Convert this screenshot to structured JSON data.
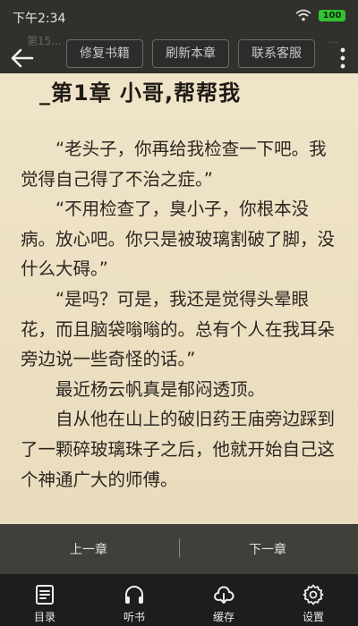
{
  "status": {
    "time": "下午2:34",
    "battery": "100"
  },
  "header": {
    "ghost_chapter": "第15...",
    "ghost_right": "...",
    "buttons": [
      "修复书籍",
      "刷新本章",
      "联系客服"
    ]
  },
  "chapter": {
    "title": "_第1章 小哥,帮帮我",
    "paragraphs": [
      "“老头子，你再给我检查一下吧。我觉得自己得了不治之症。”",
      "“不用检查了，臭小子，你根本没病。放心吧。你只是被玻璃割破了脚，没什么大碍。”",
      "“是吗？可是，我还是觉得头晕眼花，而且脑袋嗡嗡的。总有个人在我耳朵旁边说一些奇怪的话。”",
      "最近杨云帆真是郁闷透顶。",
      "自从他在山上的破旧药王庙旁边踩到了一颗碎玻璃珠子之后，他就开始自己这个神通广大的师傅。"
    ]
  },
  "chapter_nav": {
    "prev": "上一章",
    "next": "下一章"
  },
  "toolbar": {
    "items": [
      {
        "label": "目录",
        "icon": "catalog-icon"
      },
      {
        "label": "听书",
        "icon": "headphones-icon"
      },
      {
        "label": "缓存",
        "icon": "cloud-download-icon"
      },
      {
        "label": "设置",
        "icon": "gear-icon"
      }
    ]
  },
  "colors": {
    "overlay": "#1c1c1c",
    "page": "#efe3c8",
    "text": "#2b2620",
    "battery": "#33c233"
  }
}
